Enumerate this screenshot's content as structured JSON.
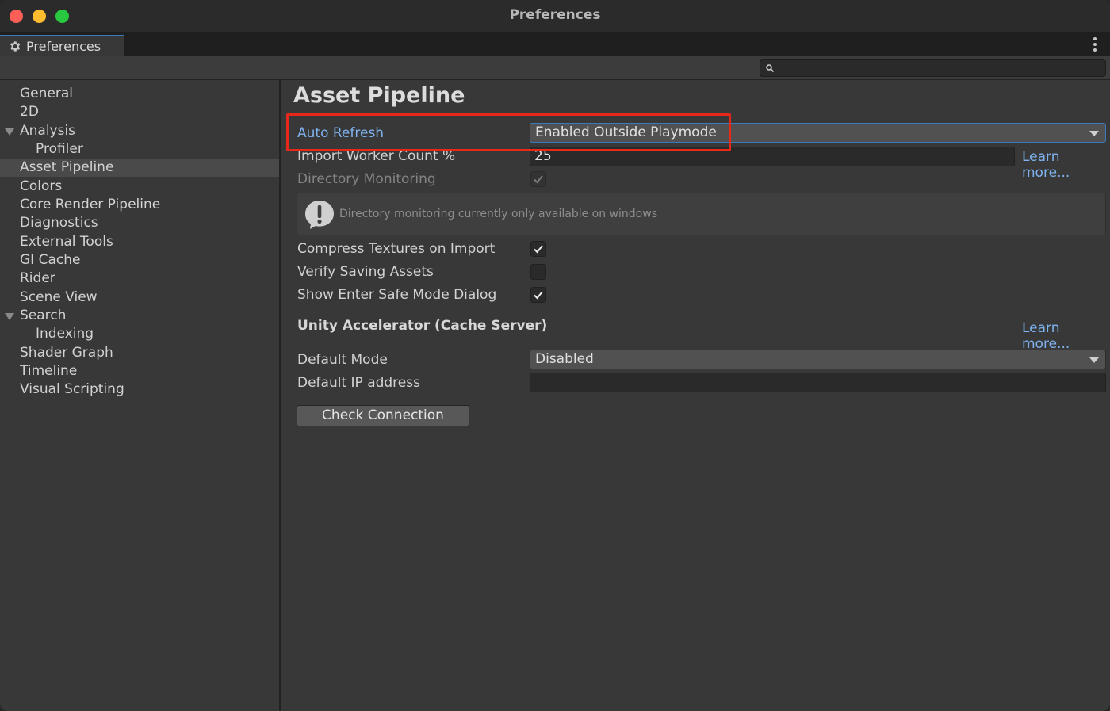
{
  "window": {
    "title": "Preferences",
    "tab_label": "Preferences"
  },
  "icons": {
    "settings": "gear-icon",
    "search": "magnifier-icon",
    "menu": "vertical-ellipsis-icon",
    "warning": "exclamation-bubble-icon",
    "check": "checkmark-icon"
  },
  "colors": {
    "accent_link": "#7fb3ef",
    "highlight_annotation": "#e8281a",
    "selection": "#4a4a4a"
  },
  "search": {
    "placeholder": ""
  },
  "sidebar": {
    "items": [
      {
        "label": "General",
        "indent": 0,
        "expandable": false,
        "selected": false
      },
      {
        "label": "2D",
        "indent": 0,
        "expandable": false,
        "selected": false
      },
      {
        "label": "Analysis",
        "indent": 0,
        "expandable": true,
        "selected": false
      },
      {
        "label": "Profiler",
        "indent": 1,
        "expandable": false,
        "selected": false
      },
      {
        "label": "Asset Pipeline",
        "indent": 0,
        "expandable": false,
        "selected": true
      },
      {
        "label": "Colors",
        "indent": 0,
        "expandable": false,
        "selected": false
      },
      {
        "label": "Core Render Pipeline",
        "indent": 0,
        "expandable": false,
        "selected": false
      },
      {
        "label": "Diagnostics",
        "indent": 0,
        "expandable": false,
        "selected": false
      },
      {
        "label": "External Tools",
        "indent": 0,
        "expandable": false,
        "selected": false
      },
      {
        "label": "GI Cache",
        "indent": 0,
        "expandable": false,
        "selected": false
      },
      {
        "label": "Rider",
        "indent": 0,
        "expandable": false,
        "selected": false
      },
      {
        "label": "Scene View",
        "indent": 0,
        "expandable": false,
        "selected": false
      },
      {
        "label": "Search",
        "indent": 0,
        "expandable": true,
        "selected": false
      },
      {
        "label": "Indexing",
        "indent": 1,
        "expandable": false,
        "selected": false
      },
      {
        "label": "Shader Graph",
        "indent": 0,
        "expandable": false,
        "selected": false
      },
      {
        "label": "Timeline",
        "indent": 0,
        "expandable": false,
        "selected": false
      },
      {
        "label": "Visual Scripting",
        "indent": 0,
        "expandable": false,
        "selected": false
      }
    ]
  },
  "main": {
    "title": "Asset Pipeline",
    "auto_refresh": {
      "label": "Auto Refresh",
      "value": "Enabled Outside Playmode"
    },
    "import_worker": {
      "label": "Import Worker Count %",
      "value": "25",
      "link": "Learn more..."
    },
    "directory_monitoring": {
      "label": "Directory Monitoring",
      "checked": true,
      "enabled": false
    },
    "help_message": "Directory monitoring currently only available on windows",
    "compress_textures": {
      "label": "Compress Textures on Import",
      "checked": true
    },
    "verify_saving": {
      "label": "Verify Saving Assets",
      "checked": false
    },
    "safe_mode": {
      "label": "Show Enter Safe Mode Dialog",
      "checked": true
    },
    "accelerator": {
      "title": "Unity Accelerator (Cache Server)",
      "link": "Learn more...",
      "default_mode": {
        "label": "Default Mode",
        "value": "Disabled"
      },
      "default_ip": {
        "label": "Default IP address",
        "value": ""
      },
      "check_button": "Check Connection"
    }
  }
}
